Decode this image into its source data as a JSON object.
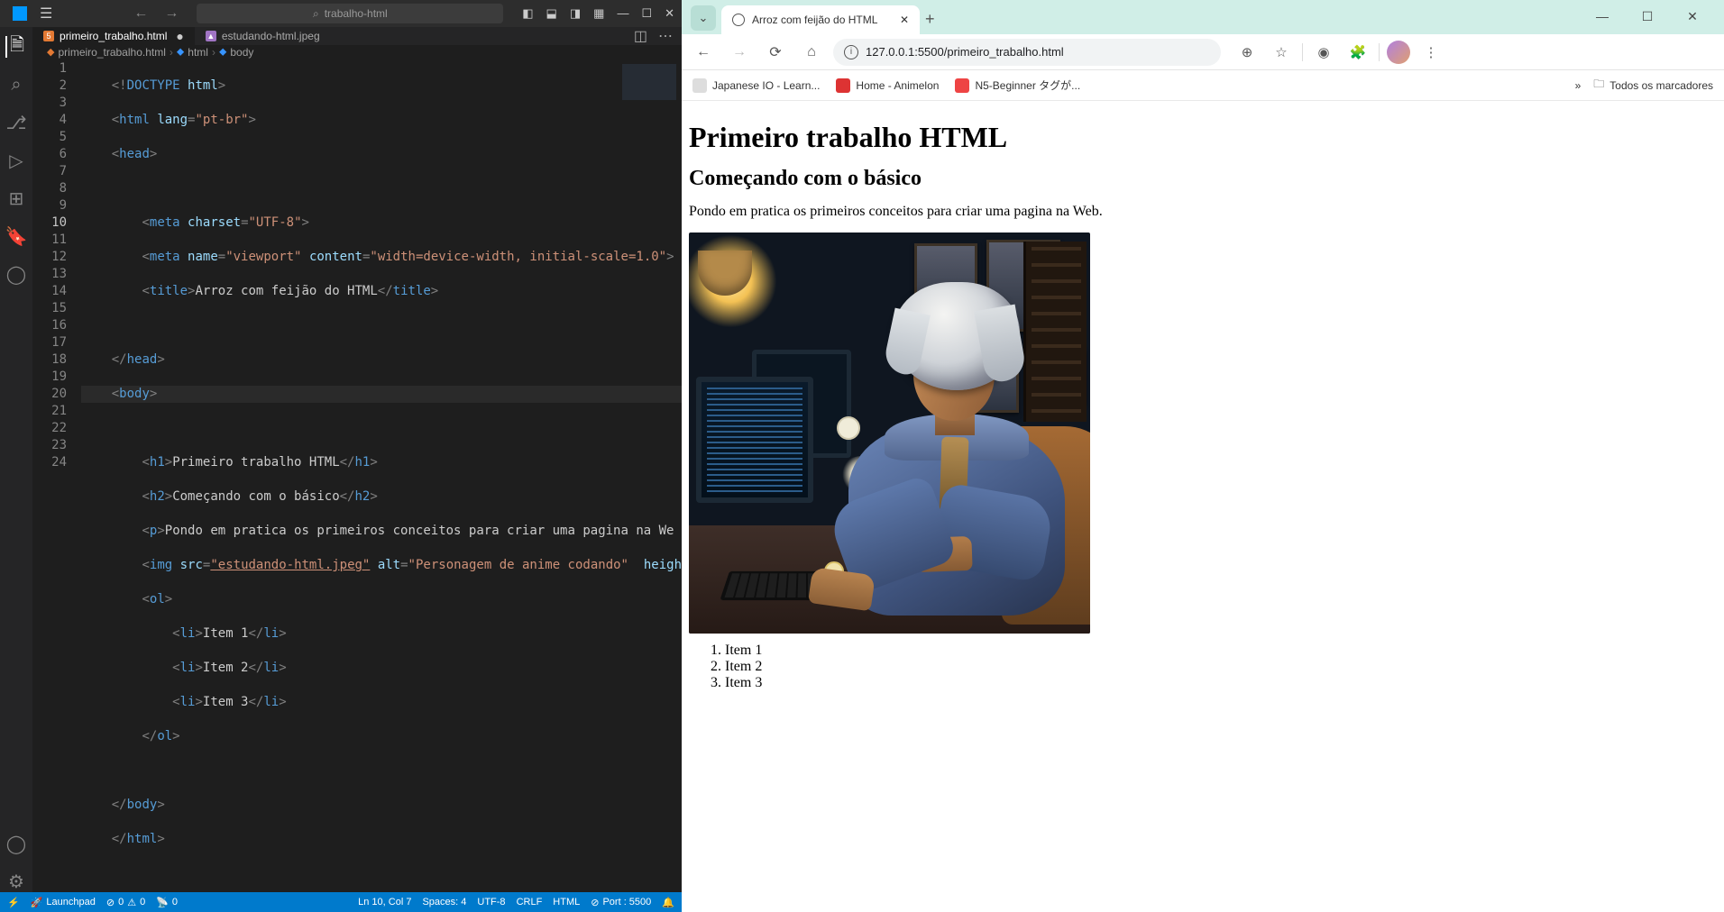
{
  "vscode": {
    "project": "trabalho-html",
    "tabs": [
      {
        "label": "primeiro_trabalho.html",
        "icon": "html",
        "active": true,
        "dirty": true
      },
      {
        "label": "estudando-html.jpeg",
        "icon": "img",
        "active": false,
        "dirty": false
      }
    ],
    "breadcrumbs": [
      "primeiro_trabalho.html",
      "html",
      "body"
    ],
    "status": {
      "remote": "",
      "launchpad": "Launchpad",
      "errors": "0",
      "warnings": "0",
      "ports": "0",
      "ln_col": "Ln 10, Col 7",
      "spaces": "Spaces: 4",
      "encoding": "UTF-8",
      "eol": "CRLF",
      "lang": "HTML",
      "port": "Port : 5500"
    },
    "lines": [
      1,
      2,
      3,
      4,
      5,
      6,
      7,
      8,
      9,
      10,
      11,
      12,
      13,
      14,
      15,
      16,
      17,
      18,
      19,
      20,
      21,
      22,
      23,
      24
    ],
    "cursorLine": 10,
    "code": {
      "l1": "<!DOCTYPE html>",
      "l2": "<html lang=\"pt-br\">",
      "l3": "<head>",
      "l5": "<meta charset=\"UTF-8\">",
      "l6": "<meta name=\"viewport\" content=\"width=device-width, initial-scale=1.0\">",
      "l7_open": "<title>",
      "l7_text": "Arroz com feijão do HTML",
      "l7_close": "</title>",
      "l9": "</head>",
      "l10": "<body>",
      "l12_open": "<h1>",
      "l12_text": "Primeiro trabalho HTML",
      "l12_close": "</h1>",
      "l13_open": "<h2>",
      "l13_text": "Começando com o básico",
      "l13_close": "</h2>",
      "l14_open": "<p>",
      "l14_text": "Pondo em pratica os primeiros conceitos para criar uma pagina na We",
      "l15_a": "<img ",
      "l15_src_attr": "src=",
      "l15_src_val": "\"estudando-html.jpeg\"",
      "l15_b": " alt=",
      "l15_alt_val": "\"Personagem de anime codando\"",
      "l15_c": " heigh",
      "l16": "<ol>",
      "l17_open": "<li>",
      "l17_text": "Item 1",
      "l17_close": "</li>",
      "l18_open": "<li>",
      "l18_text": "Item 2",
      "l18_close": "</li>",
      "l19_open": "<li>",
      "l19_text": "Item 3",
      "l19_close": "</li>",
      "l20": "</ol>",
      "l22": "</body>",
      "l23": "</html>"
    }
  },
  "browser": {
    "tab_title": "Arroz com feijão do HTML",
    "url": "127.0.0.1:5500/primeiro_trabalho.html",
    "bookmarks": [
      {
        "label": "Japanese IO - Learn..."
      },
      {
        "label": "Home - Animelon"
      },
      {
        "label": "N5-Beginner タグが..."
      }
    ],
    "all_bookmarks": "Todos os marcadores",
    "page": {
      "h1": "Primeiro trabalho HTML",
      "h2": "Começando com o básico",
      "p": "Pondo em pratica os primeiros conceitos para criar uma pagina na Web.",
      "img_alt": "Personagem de anime codando",
      "ol": [
        "Item 1",
        "Item 2",
        "Item 3"
      ]
    }
  }
}
